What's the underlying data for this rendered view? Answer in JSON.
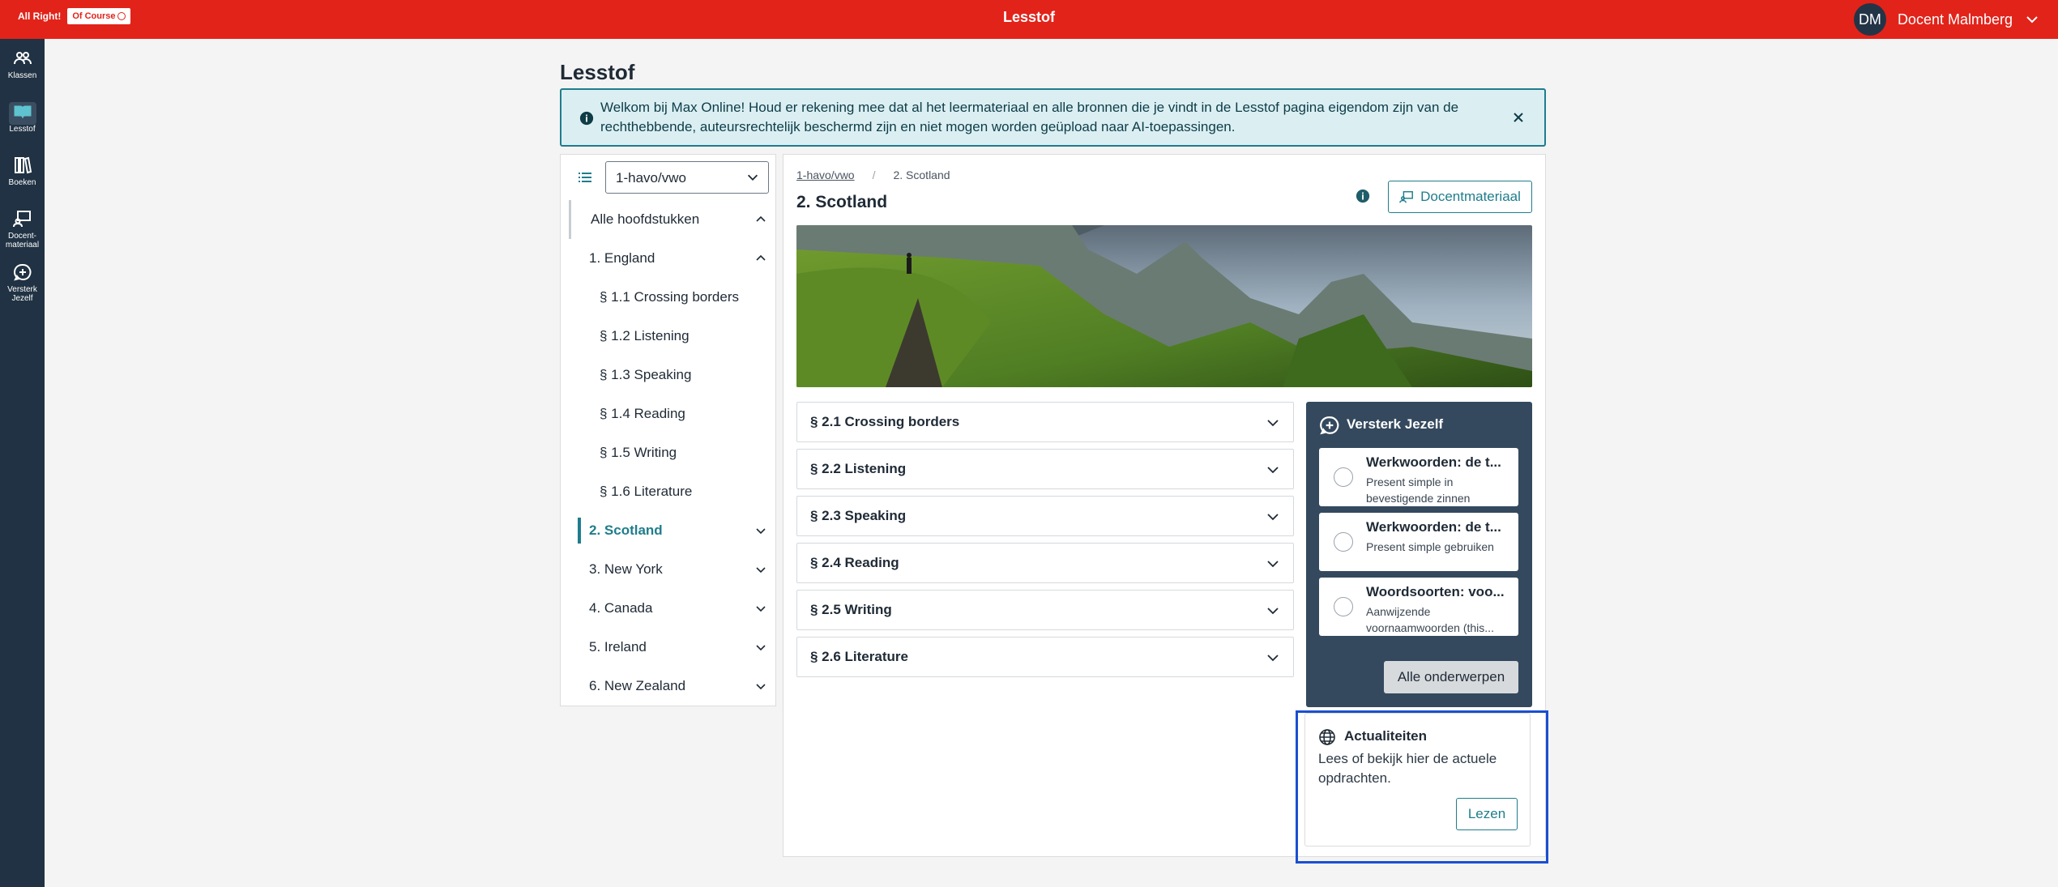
{
  "topbar": {
    "brand_text": "All Right!",
    "brand_badge": "Of Course",
    "title": "Lesstof",
    "avatar_initials": "DM",
    "user_name": "Docent Malmberg"
  },
  "rail": {
    "items": [
      {
        "label": "Klassen",
        "icon": "users-icon"
      },
      {
        "label": "Lesstof",
        "icon": "book-open-icon"
      },
      {
        "label": "Boeken",
        "icon": "books-icon"
      },
      {
        "label": "Docent-\nmateriaal",
        "icon": "teacher-icon"
      },
      {
        "label": "Versterk\nJezelf",
        "icon": "boost-icon"
      }
    ]
  },
  "page": {
    "title": "Lesstof",
    "notice": "Welkom bij Max Online! Houd er rekening mee dat al het leermateriaal en alle bronnen die je vindt in de Lesstof pagina eigendom zijn van de rechthebbende, auteursrechtelijk beschermd zijn en niet mogen worden geüpload naar AI-toepassingen."
  },
  "nav": {
    "select_value": "1-havo/vwo",
    "items": [
      {
        "label": "Alle hoofdstukken"
      },
      {
        "label": "1. England"
      },
      {
        "label": "§ 1.1 Crossing borders"
      },
      {
        "label": "§ 1.2 Listening"
      },
      {
        "label": "§ 1.3 Speaking"
      },
      {
        "label": "§ 1.4 Reading"
      },
      {
        "label": "§ 1.5 Writing"
      },
      {
        "label": "§ 1.6 Literature"
      },
      {
        "label": "2. Scotland"
      },
      {
        "label": "3. New York"
      },
      {
        "label": "4. Canada"
      },
      {
        "label": "5. Ireland"
      },
      {
        "label": "6. New Zealand"
      }
    ]
  },
  "content": {
    "breadcrumb": [
      "1-havo/vwo",
      "/",
      "2. Scotland"
    ],
    "title": "2. Scotland",
    "docent_button": "Docentmateriaal",
    "sections": [
      "§ 2.1 Crossing borders",
      "§ 2.2 Listening",
      "§ 2.3 Speaking",
      "§ 2.4 Reading",
      "§ 2.5 Writing",
      "§ 2.6 Literature"
    ]
  },
  "versterk": {
    "title": "Versterk Jezelf",
    "items": [
      {
        "title": "Werkwoorden: de t...",
        "sub": "Present simple in bevestigende zinnen"
      },
      {
        "title": "Werkwoorden: de t...",
        "sub": "Present simple gebruiken"
      },
      {
        "title": "Woordsoorten: voo...",
        "sub": "Aanwijzende voornaamwoorden (this..."
      }
    ],
    "button": "Alle onderwerpen"
  },
  "actualiteiten": {
    "title": "Actualiteiten",
    "desc": "Lees of bekijk hier de actuele opdrachten.",
    "button": "Lezen"
  },
  "colors": {
    "topbar": "#e2231a",
    "rail": "#203243",
    "accent": "#1f7d8c",
    "vj_card": "#34495e",
    "highlight": "#1a4fd1"
  }
}
